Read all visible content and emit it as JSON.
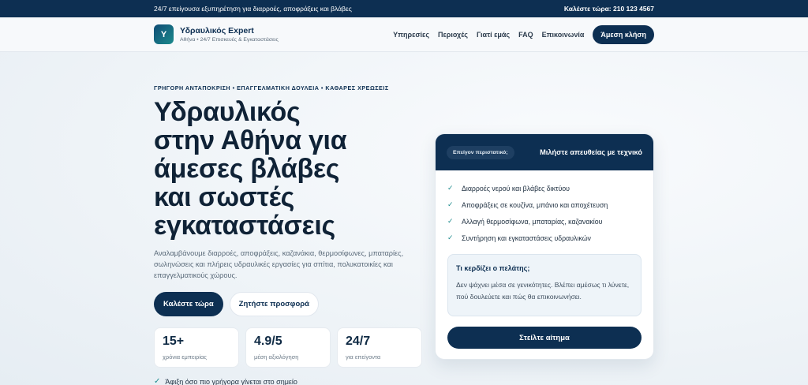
{
  "topbar": {
    "tagline": "24/7 επείγουσα εξυπηρέτηση για διαρροές, αποφράξεις και βλάβες",
    "phone": "Καλέστε τώρα: 210 123 4567"
  },
  "brand": {
    "logo_letter": "Y",
    "name": "Υδραυλικός Expert",
    "subtitle": "Αθήνα • 24/7 Επισκευές & Εγκαταστάσεις"
  },
  "nav": {
    "items": [
      {
        "label": "Υπηρεσίες"
      },
      {
        "label": "Περιοχές"
      },
      {
        "label": "Γιατί εμάς"
      },
      {
        "label": "FAQ"
      },
      {
        "label": "Επικοινωνία"
      }
    ],
    "cta": "Άμεση κλήση"
  },
  "hero": {
    "eyebrow": "ΓΡΗΓΟΡΗ ΑΝΤΑΠΟΚΡΙΣΗ • ΕΠΑΓΓΕΛΜΑΤΙΚΗ ΔΟΥΛΕΙΑ • ΚΑΘΑΡΕΣ ΧΡΕΩΣΕΙΣ",
    "headline_lines": [
      "Υδραυλικός",
      "στην Αθήνα για",
      "άμεσες βλάβες",
      "και σωστές",
      "εγκαταστάσεις"
    ],
    "description": "Αναλαμβάνουμε διαρροές, αποφράξεις, καζανάκια, θερμοσίφωνες, μπαταρίες, σωληνώσεις και πλήρεις υδραυλικές εργασίες για σπίτια, πολυκατοικίες και επαγγελματικούς χώρους.",
    "primary_button": "Καλέστε τώρα",
    "secondary_button": "Ζητήστε προσφορά",
    "stats": [
      {
        "value": "15+",
        "label": "χρόνια εμπειρίας"
      },
      {
        "value": "4.9/5",
        "label": "μέση αξιολόγηση"
      },
      {
        "value": "24/7",
        "label": "για επείγοντα"
      }
    ],
    "note": "Άφιξη όσο πιο γρήγορα γίνεται στο σημείο"
  },
  "card": {
    "chip": "Επείγον περιστατικό;",
    "title": "Μιλήστε απευθείας με τεχνικό",
    "checklist": [
      "Διαρροές νερού και βλάβες δικτύου",
      "Αποφράξεις σε κουζίνα, μπάνιο και αποχέτευση",
      "Αλλαγή θερμοσίφωνα, μπαταρίας, καζανακίου",
      "Συντήρηση και εγκαταστάσεις υδραυλικών"
    ],
    "benefit_title": "Τι κερδίζει ο πελάτης;",
    "benefit_text": "Δεν ψάχνει μέσα σε γενικότητες. Βλέπει αμέσως τι λύνετε, πού δουλεύετε και πώς θα επικοινωνήσει.",
    "submit": "Στείλτε αίτημα"
  }
}
